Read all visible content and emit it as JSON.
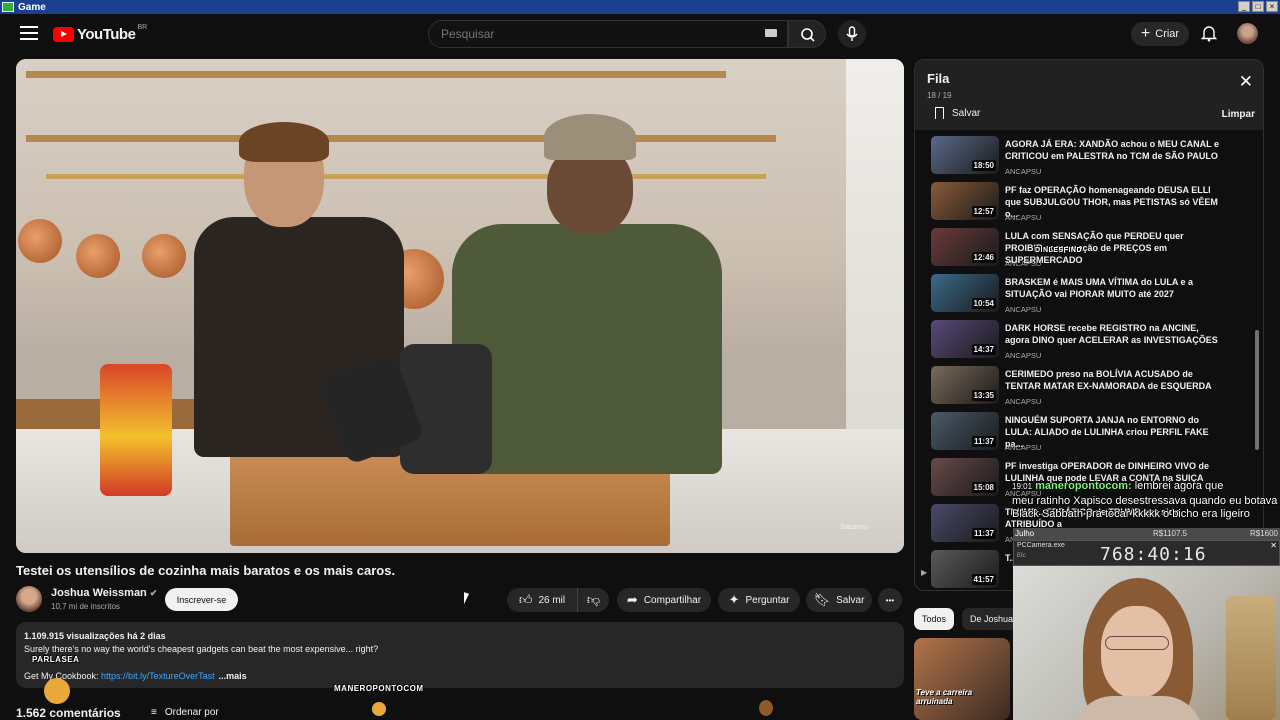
{
  "window": {
    "title": "Game"
  },
  "header": {
    "logo_text": "YouTube",
    "country": "BR",
    "search_placeholder": "Pesquisar",
    "create_label": "Criar"
  },
  "video": {
    "title": "Testei os utensílios de cozinha mais baratos e os mais caros.",
    "channel": "Joshua Weissman",
    "subscribers": "10,7 mi de inscritos",
    "subscribe_label": "Inscrever-se",
    "likes": "26 mil",
    "share_label": "Compartilhar",
    "ask_label": "Perguntar",
    "save_label": "Salvar",
    "more_label": "•••",
    "watermark": "Sabatino"
  },
  "description": {
    "meta": "1.109.915 visualizações  há 2 dias",
    "line1": "Surely there's no way the world's cheapest gadgets can beat the most expensive... right?",
    "line2_prefix": "Get My ",
    "line2_mid": "Cookbook: ",
    "link": "https://bit.ly/TextureOverTast",
    "more": "...mais"
  },
  "overlays": {
    "paralasea": "PARLASEA",
    "maneropontocom": "MANEROPONTOCOM",
    "queue_overlay": "DINLESFIND"
  },
  "comments": {
    "count": "1.562 comentários",
    "sort_label": "Ordenar por"
  },
  "queue": {
    "title": "Fila",
    "position": "18 / 19",
    "save_label": "Salvar",
    "clear_label": "Limpar",
    "items": [
      {
        "title": "AGORA JÁ ERA: XANDÃO achou o MEU CANAL e CRITICOU em PALESTRA no TCM de SÃO PAULO",
        "channel": "ANCAPSU",
        "duration": "18:50"
      },
      {
        "title": "PF faz OPERAÇÃO homenageando DEUSA ELLI que SUBJULGOU THOR, mas PETISTAS só VÊEM o...",
        "channel": "ANCAPSU",
        "duration": "12:57"
      },
      {
        "title": "LULA com SENSAÇÃO que PERDEU quer PROIBIR comparação de PREÇOS em SUPERMERCADO",
        "channel": "ANCAPSU",
        "duration": "12:46"
      },
      {
        "title": "BRASKEM é MAIS UMA VÍTIMA do LULA e a SITUAÇÃO vai PIORAR MUITO até 2027",
        "channel": "ANCAPSU",
        "duration": "10:54"
      },
      {
        "title": "DARK HORSE recebe REGISTRO na ANCINE, agora DINO quer ACELERAR as INVESTIGAÇÕES",
        "channel": "ANCAPSU",
        "duration": "14:37"
      },
      {
        "title": "CERIMEDO preso na BOLÍVIA ACUSADO de TENTAR MATAR EX-NAMORADA de ESQUERDA",
        "channel": "ANCAPSU",
        "duration": "13:35"
      },
      {
        "title": "NINGUÉM SUPORTA JANJA no ENTORNO do LULA: ALIADO de LULINHA criou PERFIL FAKE pa...",
        "channel": "ANCAPSU",
        "duration": "11:37"
      },
      {
        "title": "PF investiga OPERADOR de DINHEIRO VIVO de LULINHA que pode LEVAR a CONTA na SUIÇA",
        "channel": "ANCAPSU",
        "duration": "15:08"
      },
      {
        "title": "TRUMP... ERRÁTICO de TRUMP tem sido ATRIBUÍDO a",
        "channel": "ANCAPSU",
        "duration": "11:37"
      },
      {
        "title": "T...",
        "channel": "",
        "duration": "41:57"
      }
    ]
  },
  "related": {
    "tabs": [
      "Todos",
      "De Joshua"
    ],
    "thumb_caption": "Teve a carreira arruinada"
  },
  "stream": {
    "chat": [
      {
        "time": "19:01",
        "name": "maneropontocom:",
        "text": " lembrei agora que"
      },
      {
        "time": "",
        "name": "",
        "text": "meu ratinho Xapisco desestressava quando eu botava"
      },
      {
        "time": "",
        "name": "",
        "text": "Black Sabbath pra tocar kkkkk o bicho era ligeiro"
      }
    ],
    "split_name": "Julho",
    "split_a": "R$1107.5",
    "split_b": "R$1600",
    "timer_window": "PCCamera.exe",
    "timer_sub": "Etc",
    "timer": "768:40:16"
  },
  "colors": {
    "bg": "#0f0f0f",
    "accent": "#ff0000",
    "link": "#3ea6ff",
    "chat_name": "#7cf47c"
  }
}
